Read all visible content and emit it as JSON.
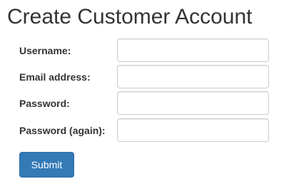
{
  "page": {
    "title": "Create Customer Account"
  },
  "form": {
    "fields": [
      {
        "label": "Username:",
        "value": "",
        "type": "text"
      },
      {
        "label": "Email address:",
        "value": "",
        "type": "email"
      },
      {
        "label": "Password:",
        "value": "",
        "type": "password"
      },
      {
        "label": "Password (again):",
        "value": "",
        "type": "password"
      }
    ],
    "submit_label": "Submit"
  },
  "colors": {
    "text": "#333333",
    "input_border": "#cccccc",
    "button_background": "#337ab7",
    "button_border": "#2e6da4",
    "button_text": "#ffffff"
  }
}
